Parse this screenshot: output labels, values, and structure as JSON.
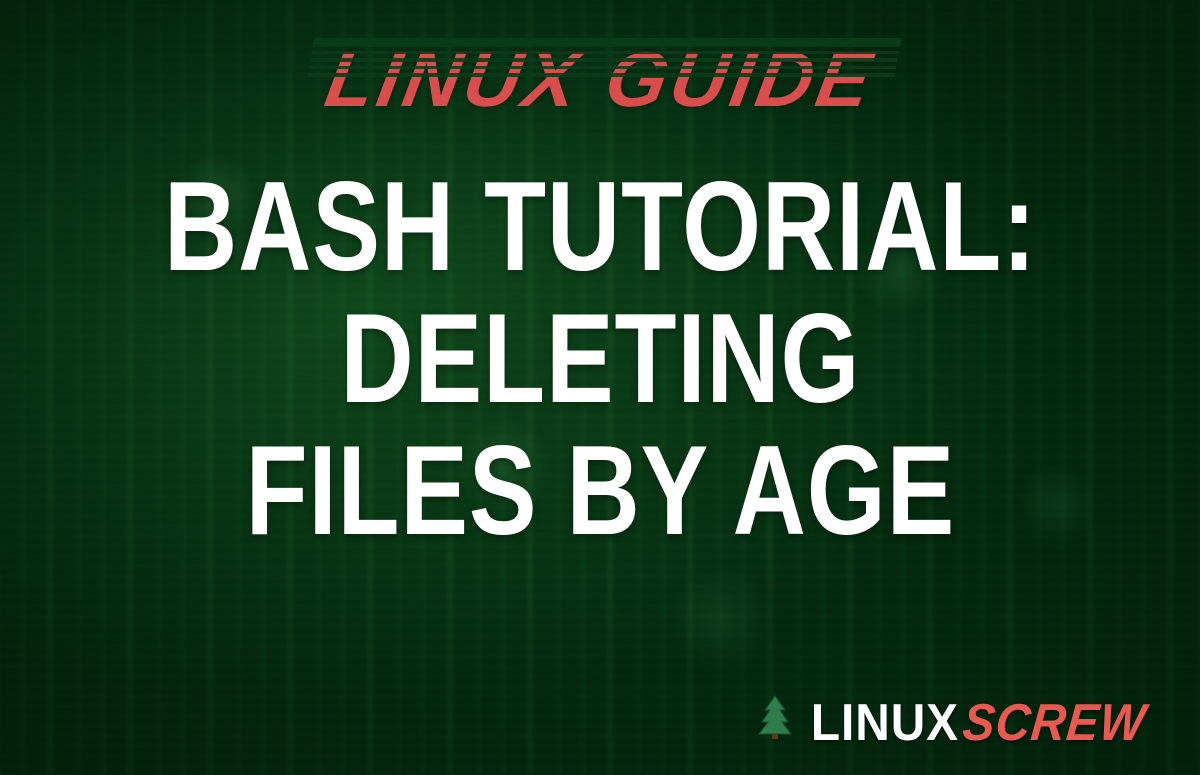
{
  "eyebrow": "LINUX GUIDE",
  "headline": {
    "line1": "BASH TUTORIAL:",
    "line2": "DELETING",
    "line3": "FILES BY AGE"
  },
  "brand": {
    "part1": "LINUX",
    "part2": "SCREW"
  },
  "colors": {
    "accent_red": "#d94d4d",
    "brand_red": "#e85a4f",
    "bg_green": "#0a3d1a",
    "text_white": "#ffffff"
  }
}
